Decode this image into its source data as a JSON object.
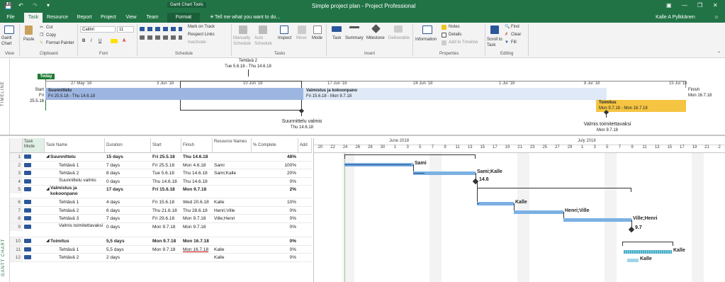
{
  "window": {
    "title": "Simple project plan - Project Professional",
    "tools_label": "Gantt Chart Tools",
    "user": "Kalle A Pylkkänen"
  },
  "tabs": [
    "File",
    "Task",
    "Resource",
    "Report",
    "Project",
    "View",
    "Team",
    "Format"
  ],
  "active_tab": "Task",
  "tell_me": "Tell me what you want to do...",
  "ribbon": {
    "view": {
      "gantt": "Gantt Chart",
      "group": "View"
    },
    "clipboard": {
      "paste": "Paste",
      "cut": "Cut",
      "copy": "Copy",
      "format_painter": "Format Painter",
      "group": "Clipboard"
    },
    "font": {
      "family": "Calibri",
      "size": "11",
      "group": "Font"
    },
    "schedule": {
      "mark_on_track": "Mark on Track",
      "respect_links": "Respect Links",
      "inactivate": "Inactivate",
      "group": "Schedule"
    },
    "tasks": {
      "manually": "Manually Schedule",
      "auto": "Auto Schedule",
      "inspect": "Inspect",
      "move": "Move",
      "mode": "Mode",
      "group": "Tasks"
    },
    "insert": {
      "task": "Task",
      "summary": "Summary",
      "milestone": "Milestone",
      "deliverable": "Deliverable",
      "group": "Insert"
    },
    "properties": {
      "information": "Information",
      "notes": "Notes",
      "details": "Details",
      "add_to_timeline": "Add to Timeline",
      "group": "Properties"
    },
    "editing": {
      "scroll": "Scroll to Task",
      "find": "Find",
      "clear": "Clear",
      "fill": "Fill",
      "group": "Editing"
    }
  },
  "timeline": {
    "side_label": "TIMELINE",
    "today": "Today",
    "start_label": "Start",
    "start_date": "Fri 25.5.18",
    "finish_label": "Finish",
    "finish_date": "Mon 16.7.18",
    "ticks": [
      "27 May '18",
      "3 Jun '18",
      "10 Jun '18",
      "17 Jun '18",
      "24 Jun '18",
      "1 Jul '18",
      "8 Jul '18",
      "15 Jul '18"
    ],
    "callout_top": {
      "name": "Tehtävä 2",
      "dates": "Tue 5.6.18 - Thu 14.6.18"
    },
    "bars": [
      {
        "name": "Suunnittelu",
        "dates": "Fri 25.5.18 - Thu 14.6.18"
      },
      {
        "name": "Valmistus ja kokoonpano",
        "dates": "Fri 15.6.18 - Mon 9.7.18"
      },
      {
        "name": "Toimitus",
        "dates": "Mon 9.7.18 - Mon 16.7.18"
      }
    ],
    "milestones": [
      {
        "name": "Suunnittelu valmis",
        "date": "Thu 14.6.18"
      },
      {
        "name": "Valmis toimitettavaksi",
        "date": "Mon 9.7.18"
      }
    ]
  },
  "gantt_side_label": "GANTT CHART",
  "table": {
    "headers": {
      "mode": "Task Mode",
      "name": "Task Name",
      "duration": "Duration",
      "start": "Start",
      "finish": "Finish",
      "resources": "Resource Names",
      "complete": "% Complete",
      "add": "Add"
    },
    "rows": [
      {
        "id": "1",
        "name": "Suunnittelu",
        "duration": "15 days",
        "start": "Fri 25.5.18",
        "finish": "Thu 14.6.18",
        "res": "",
        "pct": "48%",
        "summary": true
      },
      {
        "id": "2",
        "name": "Tehtävä 1",
        "duration": "7 days",
        "start": "Fri 25.5.18",
        "finish": "Mon 4.6.18",
        "res": "Sami",
        "pct": "100%",
        "summary": false
      },
      {
        "id": "3",
        "name": "Tehtävä 2",
        "duration": "8 days",
        "start": "Tue 5.6.18",
        "finish": "Thu 14.6.18",
        "res": "Sami;Kalle",
        "pct": "20%",
        "summary": false
      },
      {
        "id": "4",
        "name": "Suunnittelu valmis",
        "duration": "0 days",
        "start": "Thu 14.6.18",
        "finish": "Thu 14.6.18",
        "res": "",
        "pct": "0%",
        "summary": false
      },
      {
        "id": "5",
        "name": "Valmistus ja kokoonpano",
        "duration": "17 days",
        "start": "Fri 15.6.18",
        "finish": "Mon 9.7.18",
        "res": "",
        "pct": "2%",
        "summary": true
      },
      {
        "id": "6",
        "name": "Tehtävä 1",
        "duration": "4 days",
        "start": "Fri 15.6.18",
        "finish": "Wed 20.6.18",
        "res": "Kalle",
        "pct": "10%",
        "summary": false
      },
      {
        "id": "7",
        "name": "Tehtävä 2",
        "duration": "6 days",
        "start": "Thu 21.6.18",
        "finish": "Thu 28.6.18",
        "res": "Henri;Ville",
        "pct": "0%",
        "summary": false
      },
      {
        "id": "8",
        "name": "Tehtävä 3",
        "duration": "7 days",
        "start": "Fri 29.6.18",
        "finish": "Mon 9.7.18",
        "res": "Ville;Henri",
        "pct": "0%",
        "summary": false
      },
      {
        "id": "9",
        "name": "Valmis toimitettavaksi",
        "duration": "0 days",
        "start": "Mon 9.7.18",
        "finish": "Mon 9.7.18",
        "res": "",
        "pct": "0%",
        "summary": false
      },
      {
        "id": "10",
        "name": "Toimitus",
        "duration": "5,5 days",
        "start": "Mon 9.7.18",
        "finish": "Mon 16.7.18",
        "res": "",
        "pct": "0%",
        "summary": true
      },
      {
        "id": "11",
        "name": "Tehtävä 1",
        "duration": "5,5 days",
        "start": "Mon 9.7.18",
        "finish": "Mon 16.7.18",
        "res": "Kalle",
        "pct": "0%",
        "summary": false
      },
      {
        "id": "12",
        "name": "Tehtävä 2",
        "duration": "2 days",
        "start": "",
        "finish": "",
        "res": "Kalle",
        "pct": "0%",
        "summary": false
      }
    ]
  },
  "chart": {
    "months": [
      "June 2018",
      "July 2018"
    ],
    "days": [
      "20",
      "22",
      "24",
      "26",
      "28",
      "30",
      "1",
      "3",
      "5",
      "7",
      "9",
      "11",
      "13",
      "15",
      "17",
      "19",
      "21",
      "23",
      "25",
      "27",
      "29",
      "1",
      "3",
      "5",
      "7",
      "9",
      "11",
      "13",
      "15",
      "17",
      "19",
      "21",
      "2"
    ],
    "bar_labels": [
      "Sami",
      "Sami;Kalle",
      "14.6",
      "Kalle",
      "Henri;Ville",
      "Ville;Henri",
      "9.7",
      "Kalle",
      "Kalle"
    ]
  }
}
